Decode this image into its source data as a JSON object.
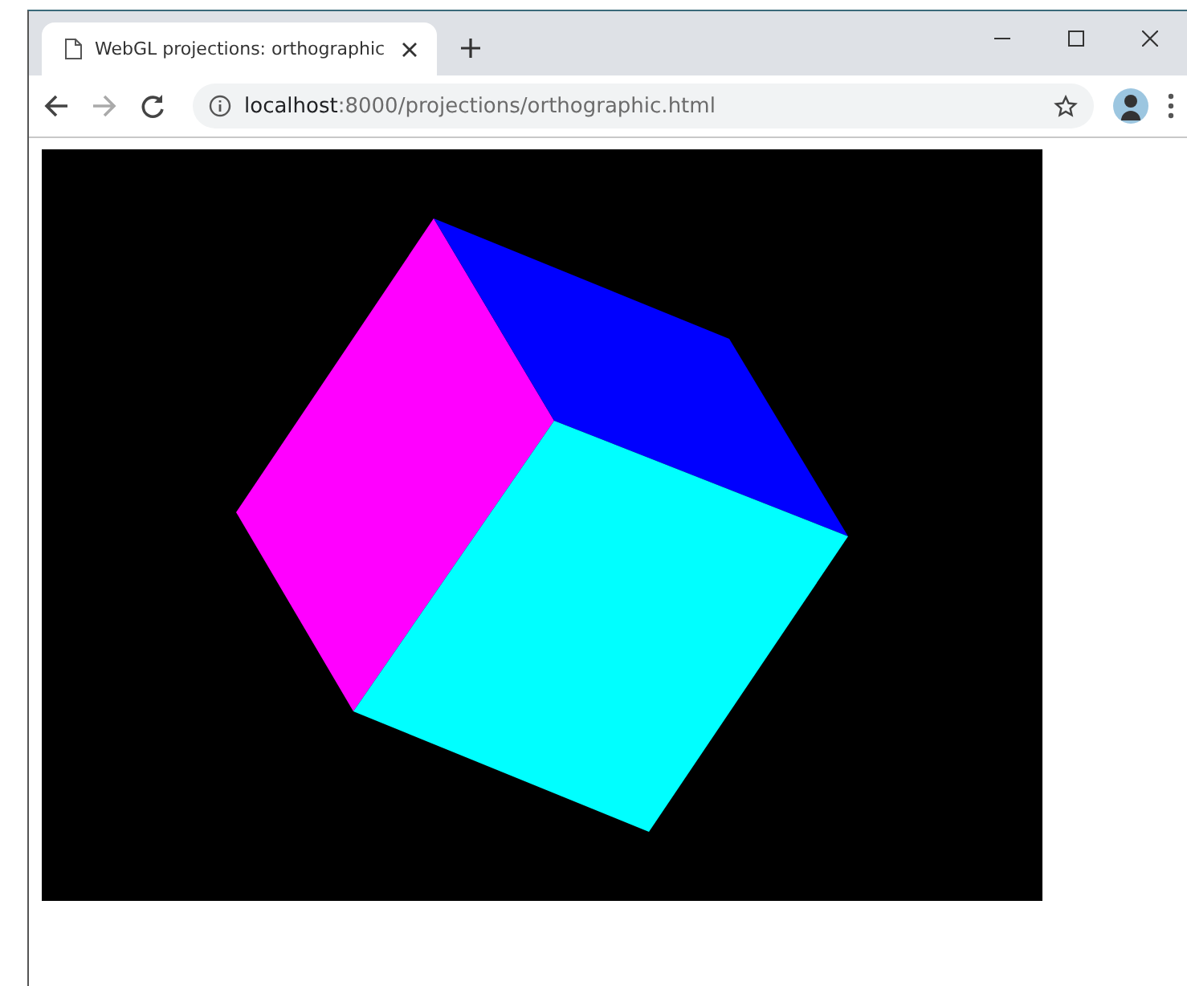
{
  "tabs": [
    {
      "title": "WebGL projections: orthographic",
      "selected": true
    }
  ],
  "address_bar": {
    "host": "localhost",
    "path": ":8000/projections/orthographic.html"
  }
}
